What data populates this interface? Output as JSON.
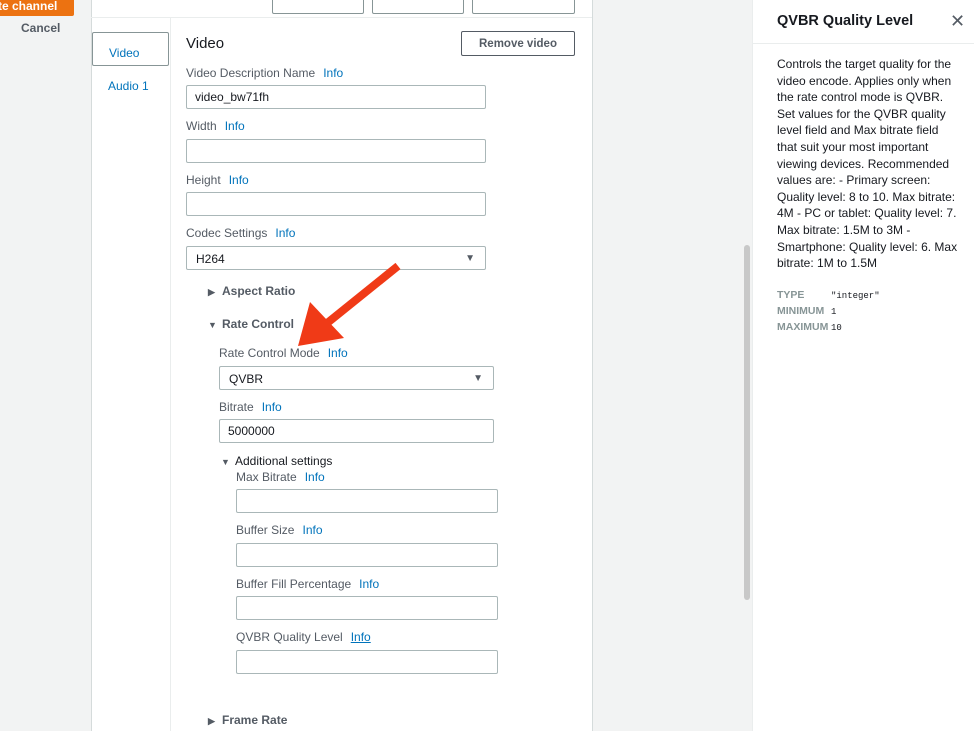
{
  "header": {
    "create_label": "te channel",
    "cancel_label": "Cancel"
  },
  "tabs": [
    {
      "label": "Video"
    },
    {
      "label": "Audio 1"
    }
  ],
  "video": {
    "title": "Video",
    "remove_label": "Remove video",
    "info_label": "Info",
    "description_name": {
      "label": "Video Description Name",
      "value": "video_bw71fh"
    },
    "width": {
      "label": "Width",
      "value": ""
    },
    "height": {
      "label": "Height",
      "value": ""
    },
    "codec": {
      "label": "Codec Settings",
      "value": "H264"
    },
    "aspect_ratio": {
      "label": "Aspect Ratio",
      "expanded": false
    },
    "rate_control": {
      "label": "Rate Control",
      "expanded": true,
      "mode": {
        "label": "Rate Control Mode",
        "value": "QVBR"
      },
      "bitrate": {
        "label": "Bitrate",
        "value": "5000000"
      },
      "additional": {
        "label": "Additional settings",
        "expanded": true,
        "max_bitrate": {
          "label": "Max Bitrate",
          "value": ""
        },
        "buffer_size": {
          "label": "Buffer Size",
          "value": ""
        },
        "buffer_fill": {
          "label": "Buffer Fill Percentage",
          "value": ""
        },
        "qvbr_level": {
          "label": "QVBR Quality Level",
          "value": ""
        }
      }
    },
    "frame_rate": {
      "label": "Frame Rate",
      "expanded": false
    }
  },
  "help": {
    "title": "QVBR Quality Level",
    "body": "Controls the target quality for the video encode. Applies only when the rate control mode is QVBR. Set values for the QVBR quality level field and Max bitrate field that suit your most important viewing devices. Recommended values are: - Primary screen: Quality level: 8 to 10. Max bitrate: 4M - PC or tablet: Quality level: 7. Max bitrate: 1.5M to 3M - Smartphone: Quality level: 6. Max bitrate: 1M to 1.5M",
    "type_key": "TYPE",
    "type_val": "\"integer\"",
    "min_key": "MINIMUM",
    "min_val": "1",
    "max_key": "MAXIMUM",
    "max_val": "10"
  },
  "colors": {
    "accent": "#ec7211",
    "link": "#0073bb",
    "arrow": "#f03a17"
  },
  "icons": {
    "close": "close-icon",
    "dropdown": "chevron-down-icon",
    "expanded": "caret-down-icon",
    "collapsed": "caret-right-icon"
  }
}
